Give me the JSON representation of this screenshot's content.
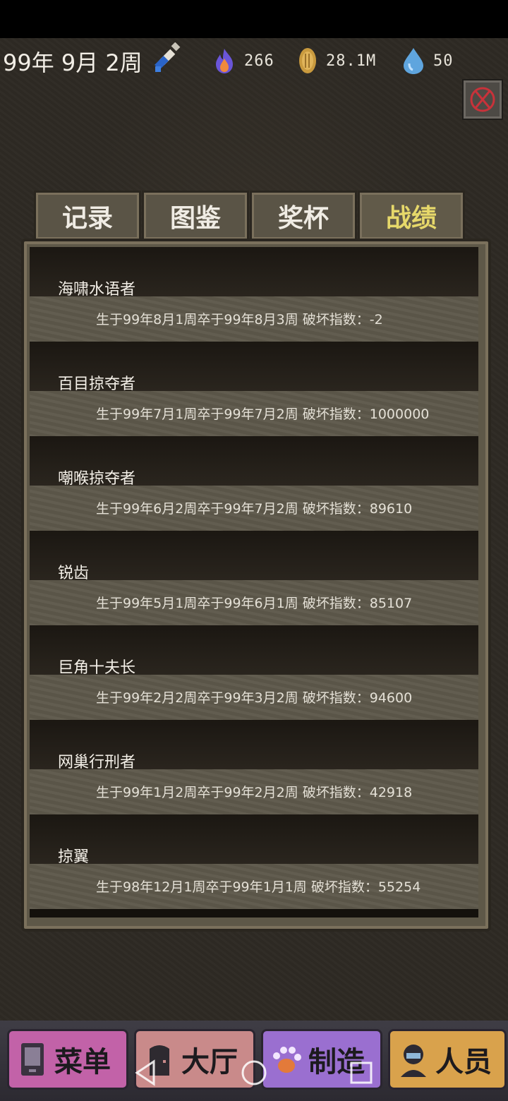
{
  "topbar": {
    "date": "99年 9月 2周",
    "resources": [
      {
        "icon": "flame-icon",
        "value": "266"
      },
      {
        "icon": "coin-icon",
        "value": "28.1M"
      },
      {
        "icon": "water-drop-icon",
        "value": "50"
      }
    ]
  },
  "tabs": [
    {
      "label": "记录",
      "active": false
    },
    {
      "label": "图鉴",
      "active": false
    },
    {
      "label": "奖杯",
      "active": false
    },
    {
      "label": "战绩",
      "active": true
    }
  ],
  "records": [
    {
      "name": "海啸水语者",
      "info": "生于99年8月1周卒于99年8月3周  破坏指数：-2"
    },
    {
      "name": "百目掠夺者",
      "info": "生于99年7月1周卒于99年7月2周  破坏指数：1000000"
    },
    {
      "name": "嘲喉掠夺者",
      "info": "生于99年6月2周卒于99年7月2周  破坏指数：89610"
    },
    {
      "name": "锐齿",
      "info": "生于99年5月1周卒于99年6月1周  破坏指数：85107"
    },
    {
      "name": "巨角十夫长",
      "info": "生于99年2月2周卒于99年3月2周  破坏指数：94600"
    },
    {
      "name": "网巢行刑者",
      "info": "生于99年1月2周卒于99年2月2周  破坏指数：42918"
    },
    {
      "name": "掠翼",
      "info": "生于98年12月1周卒于99年1月1周  破坏指数：55254"
    }
  ],
  "bottom_nav": [
    {
      "label": "菜单",
      "icon": "tablet-icon",
      "color": "#c262a8"
    },
    {
      "label": "大厅",
      "icon": "door-icon",
      "color": "#c98a8a"
    },
    {
      "label": "制造",
      "icon": "paw-icon",
      "color": "#9a6fd0"
    },
    {
      "label": "人员",
      "icon": "person-icon",
      "color": "#d9a24c"
    }
  ],
  "system_nav": [
    "back-icon",
    "home-icon",
    "recents-icon"
  ]
}
